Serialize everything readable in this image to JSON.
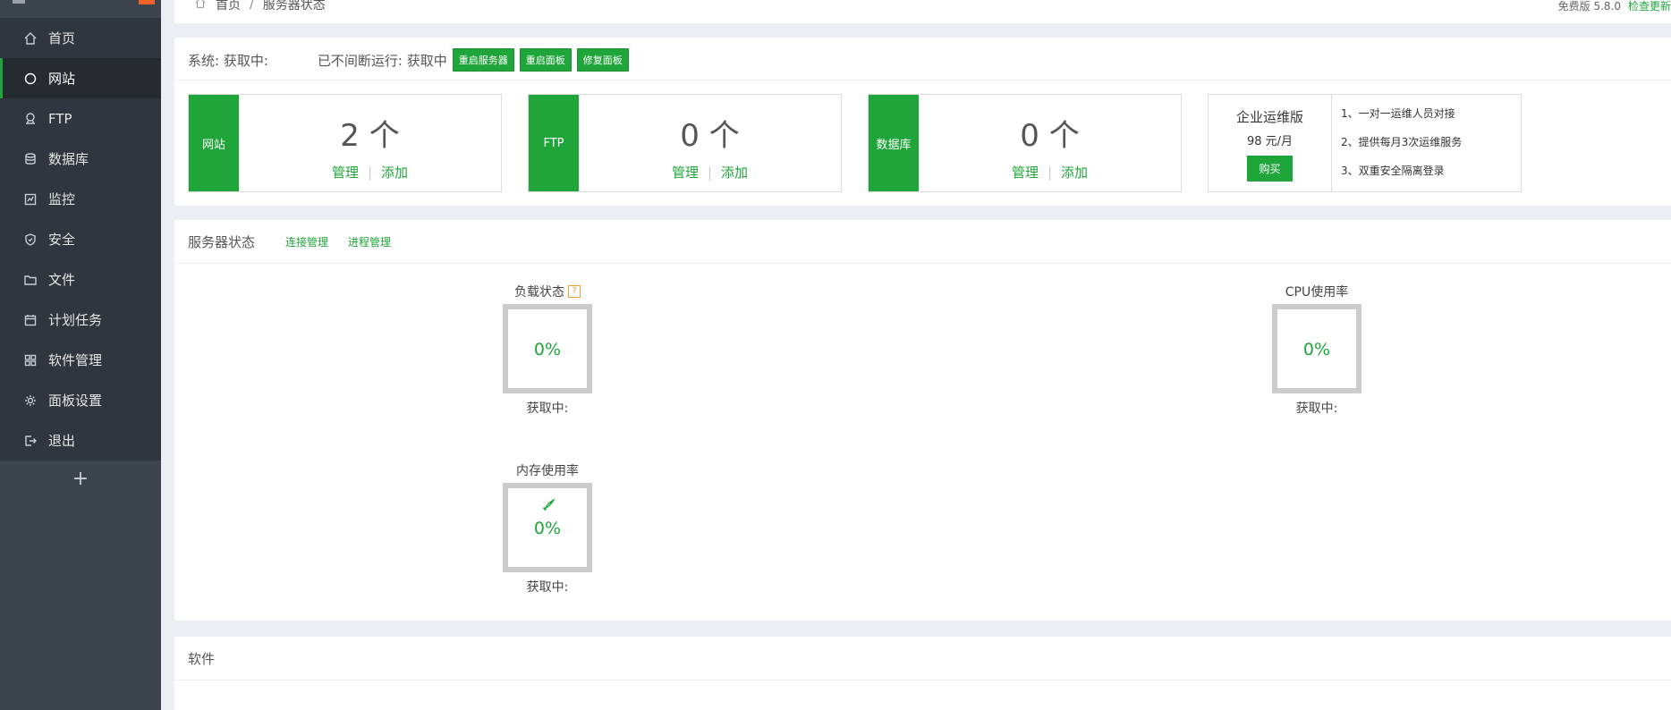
{
  "sidebar": {
    "items": [
      {
        "label": "首页",
        "icon": "home-icon",
        "active": false
      },
      {
        "label": "网站",
        "icon": "globe-icon",
        "active": true
      },
      {
        "label": "FTP",
        "icon": "ftp-icon",
        "active": false
      },
      {
        "label": "数据库",
        "icon": "database-icon",
        "active": false
      },
      {
        "label": "监控",
        "icon": "monitor-icon",
        "active": false
      },
      {
        "label": "安全",
        "icon": "shield-icon",
        "active": false
      },
      {
        "label": "文件",
        "icon": "folder-icon",
        "active": false
      },
      {
        "label": "计划任务",
        "icon": "calendar-icon",
        "active": false
      },
      {
        "label": "软件管理",
        "icon": "grid-icon",
        "active": false
      },
      {
        "label": "面板设置",
        "icon": "gear-icon",
        "active": false
      },
      {
        "label": "退出",
        "icon": "logout-icon",
        "active": false
      }
    ],
    "add_label": "+"
  },
  "breadcrumb": {
    "home": "首页",
    "sep": "/",
    "current": "服务器状态"
  },
  "version": {
    "text": "免费版 5.8.0",
    "update": "检查更新"
  },
  "system": {
    "os_label": "系统: 获取中:",
    "uptime_label": "已不间断运行: 获取中",
    "buttons": [
      "重启服务器",
      "重启面板",
      "修复面板"
    ]
  },
  "stats": [
    {
      "tag": "网站",
      "count": "2 个",
      "manage": "管理",
      "sep": "|",
      "add": "添加"
    },
    {
      "tag": "FTP",
      "count": "0 个",
      "manage": "管理",
      "sep": "|",
      "add": "添加"
    },
    {
      "tag": "数据库",
      "count": "0 个",
      "manage": "管理",
      "sep": "|",
      "add": "添加"
    }
  ],
  "enterprise": {
    "title": "企业运维版",
    "price": "98 元/月",
    "buy": "购买",
    "features": [
      "1、一对一运维人员对接",
      "2、提供每月3次运维服务",
      "3、双重安全隔离登录"
    ]
  },
  "server_status": {
    "title": "服务器状态",
    "links": [
      "连接管理",
      "进程管理"
    ],
    "gauges": {
      "load": {
        "title": "负载状态",
        "help": "?",
        "value": "0%",
        "sub": "获取中:"
      },
      "cpu": {
        "title": "CPU使用率",
        "value": "0%",
        "sub": "获取中:"
      },
      "memory": {
        "title": "内存使用率",
        "value": "0%",
        "sub": "获取中:"
      }
    }
  },
  "software": {
    "title": "软件"
  },
  "colors": {
    "accent": "#20a53a",
    "sidebar": "#3c444d",
    "warning": "#f0a030"
  }
}
